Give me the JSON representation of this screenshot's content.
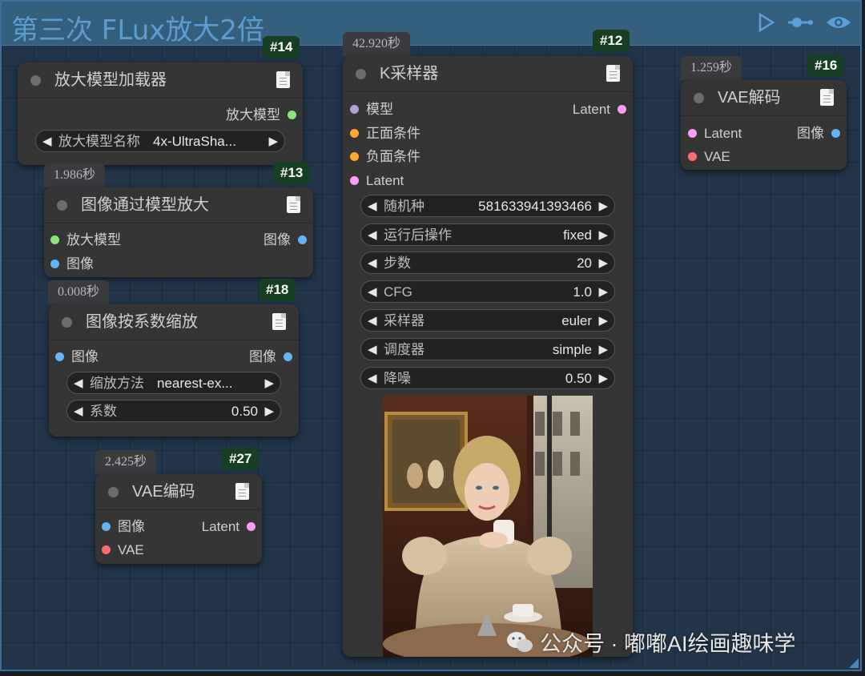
{
  "group": {
    "title": "第三次 FLux放大2倍",
    "icons": [
      "play-outline-icon",
      "node-link-icon",
      "eye-icon"
    ]
  },
  "colors": {
    "model": "#b39ddb",
    "positive": "#ffa931",
    "negative": "#ffa931",
    "latent": "#ff9cf9",
    "upscale_model": "#8be57a",
    "image": "#64b5f6",
    "vae": "#ff6e6e",
    "badge": "#163f25"
  },
  "nodes": {
    "n14": {
      "id": "#14",
      "title": "放大模型加载器",
      "outputs": [
        "放大模型"
      ],
      "widgets": [
        {
          "label": "放大模型名称",
          "value": "4x-UltraSha..."
        }
      ]
    },
    "n13": {
      "id": "#13",
      "time": "1.986秒",
      "title": "图像通过模型放大",
      "inputs": [
        "放大模型",
        "图像"
      ],
      "outputs": [
        "图像"
      ]
    },
    "n18": {
      "id": "#18",
      "time": "0.008秒",
      "title": "图像按系数缩放",
      "inputs": [
        "图像"
      ],
      "outputs": [
        "图像"
      ],
      "widgets": [
        {
          "label": "缩放方法",
          "value": "nearest-ex..."
        },
        {
          "label": "系数",
          "value": "0.50"
        }
      ]
    },
    "n27": {
      "id": "#27",
      "time": "2.425秒",
      "title": "VAE编码",
      "inputs": [
        "图像",
        "VAE"
      ],
      "outputs": [
        "Latent"
      ]
    },
    "n12": {
      "id": "#12",
      "time": "42.920秒",
      "title": "K采样器",
      "inputs": [
        "模型",
        "正面条件",
        "负面条件",
        "Latent"
      ],
      "outputs": [
        "Latent"
      ],
      "widgets": [
        {
          "label": "随机种",
          "value": "581633941393466"
        },
        {
          "label": "运行后操作",
          "value": "fixed"
        },
        {
          "label": "步数",
          "value": "20"
        },
        {
          "label": "CFG",
          "value": "1.0"
        },
        {
          "label": "采样器",
          "value": "euler"
        },
        {
          "label": "调度器",
          "value": "simple"
        },
        {
          "label": "降噪",
          "value": "0.50"
        }
      ]
    },
    "n16": {
      "id": "#16",
      "time": "1.259秒",
      "title": "VAE解码",
      "inputs": [
        "Latent",
        "VAE"
      ],
      "outputs": [
        "图像"
      ]
    }
  },
  "widget_arrows": {
    "left": "◀",
    "right": "▶"
  },
  "watermark": {
    "text": "公众号 · 嘟嘟AI绘画趣味学"
  }
}
